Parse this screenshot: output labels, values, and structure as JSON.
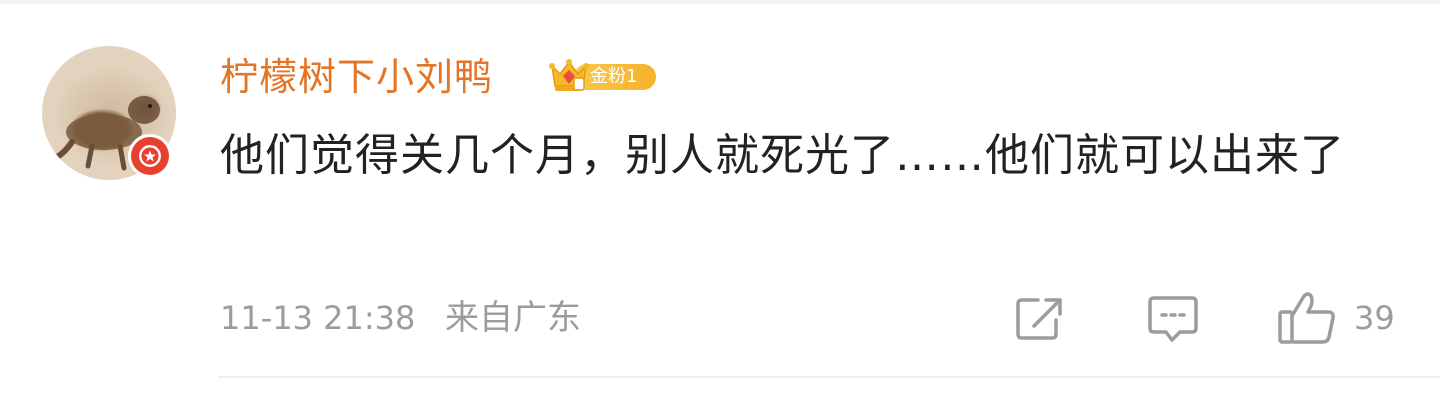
{
  "comment": {
    "username": "柠檬树下小刘鸭",
    "fan_badge": {
      "label": "金粉1",
      "icon": "crown-icon",
      "color": "#f5b22c"
    },
    "avatar_badge_icon": "red-star-icon",
    "text": "他们觉得关几个月，别人就死光了……他们就可以出来了",
    "timestamp": "11-13 21:38",
    "location": "来自广东",
    "actions": {
      "share_icon": "share-icon",
      "reply_icon": "comment-icon",
      "like_icon": "thumbs-up-icon",
      "like_count": "39"
    }
  },
  "colors": {
    "username": "#e57526",
    "text": "#222222",
    "meta": "#9c9c9c",
    "badge_red": "#e8402e"
  }
}
